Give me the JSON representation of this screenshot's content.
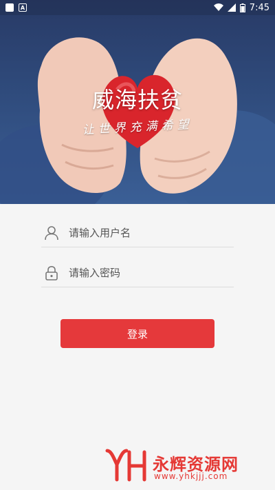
{
  "status_bar": {
    "time": "7:45",
    "icons": [
      "notification-square-icon",
      "a-icon",
      "wifi-icon",
      "signal-icon",
      "battery-icon"
    ]
  },
  "hero": {
    "title": "威海扶贫",
    "subtitle": "让世界充满希望"
  },
  "form": {
    "username_placeholder": "请输入用户名",
    "password_placeholder": "请输入密码",
    "username_value": "",
    "password_value": ""
  },
  "login_button_label": "登录",
  "watermark": {
    "text": "永辉资源网",
    "url": "www.yhkjjj.com"
  },
  "colors": {
    "accent": "#e5393b",
    "background": "#f5f5f5",
    "hero": "#2f4b7c"
  }
}
